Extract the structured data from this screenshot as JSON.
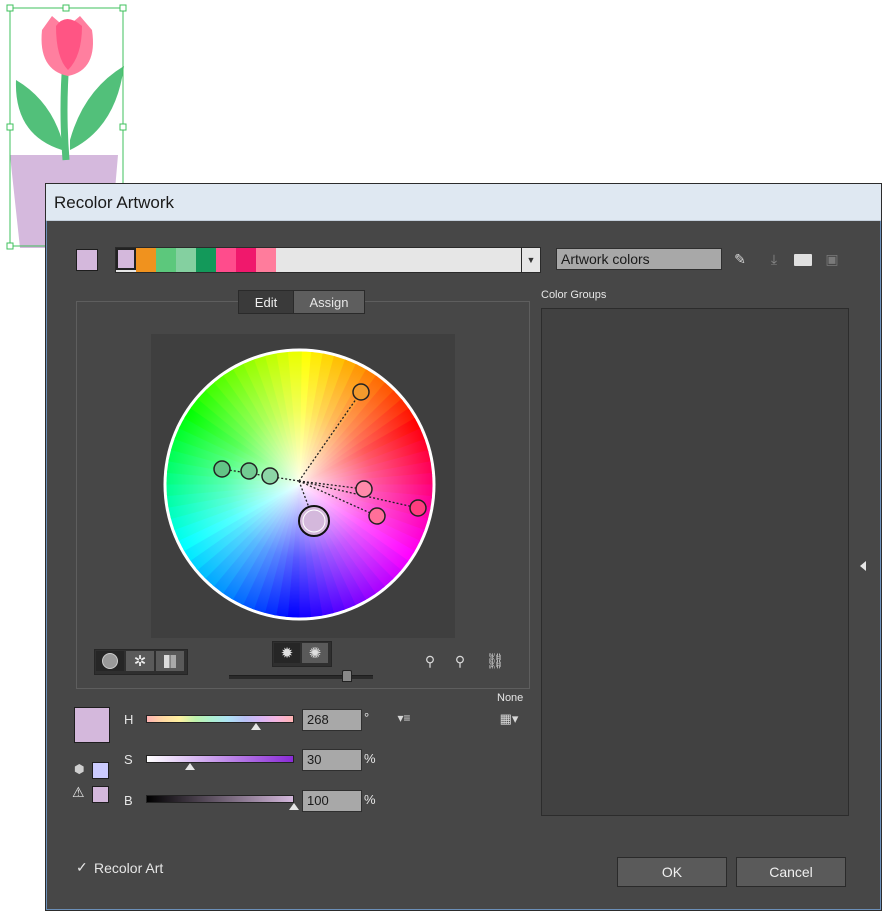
{
  "dialog": {
    "title": "Recolor Artwork"
  },
  "active_color_hex": "#d4b8dc",
  "color_strip": [
    "#d4b8dc",
    "#f0921e",
    "#5cc87c",
    "#84d0a0",
    "#13995a",
    "#ff4c8c",
    "#f0186c",
    "#ff7c9c"
  ],
  "group_name_field": {
    "value": "Artwork colors"
  },
  "tabs": {
    "edit": "Edit",
    "assign": "Assign"
  },
  "color_groups": {
    "label": "Color Groups"
  },
  "none_label": "None",
  "hsb": {
    "h": {
      "label": "H",
      "value": "268",
      "unit": "°"
    },
    "s": {
      "label": "S",
      "value": "30",
      "unit": "%"
    },
    "b": {
      "label": "B",
      "value": "100",
      "unit": "%"
    }
  },
  "recolor_art": {
    "label": "Recolor Art",
    "checked": true
  },
  "buttons": {
    "ok": "OK",
    "cancel": "Cancel"
  },
  "icons": {
    "eyedropper": "eyedropper-icon",
    "save": "save-group-icon",
    "folder": "new-folder-icon",
    "trash": "trash-icon",
    "add_color": "add-color-tool-icon",
    "remove_color": "remove-color-tool-icon",
    "link": "link-harmony-icon"
  }
}
